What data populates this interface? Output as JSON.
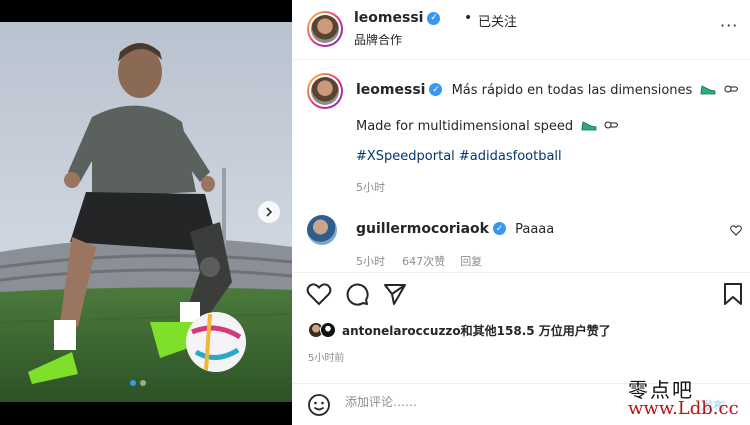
{
  "header": {
    "username": "leomessi",
    "separator": "•",
    "follow_status": "已关注",
    "subtitle": "品牌合作",
    "more": "···"
  },
  "caption": {
    "username": "leomessi",
    "line1": "Más rápido en todas las dimensiones",
    "line2": "Made for multidimensional speed",
    "hashtags": "#XSpeedportal #adidasfootball",
    "time": "5小时"
  },
  "comment": {
    "username": "guillermocoriaok",
    "text": "Paaaa",
    "time": "5小时",
    "likes": "647次赞",
    "reply": "回复"
  },
  "likes": {
    "text": "antonelaroccuzzo和其他158.5 万位用户赞了"
  },
  "post_time": "5小时前",
  "add_comment": {
    "placeholder": "添加评论……",
    "post_label": "发布"
  },
  "watermark": {
    "cn": "零点吧",
    "url": "www.Ldb.cc"
  },
  "colors": {
    "verified": "#3897f0",
    "hashtag": "#00376b",
    "muted": "#8e8e8e",
    "post_button": "#b2dffc"
  },
  "icons": {
    "like": "heart-icon",
    "comment": "comment-icon",
    "share": "send-icon",
    "save": "bookmark-icon",
    "emoji": "emoji-icon",
    "shoe": "shoe-emoji-icon",
    "point": "pointing-hand-icon",
    "carousel_next": "chevron-right-icon"
  }
}
